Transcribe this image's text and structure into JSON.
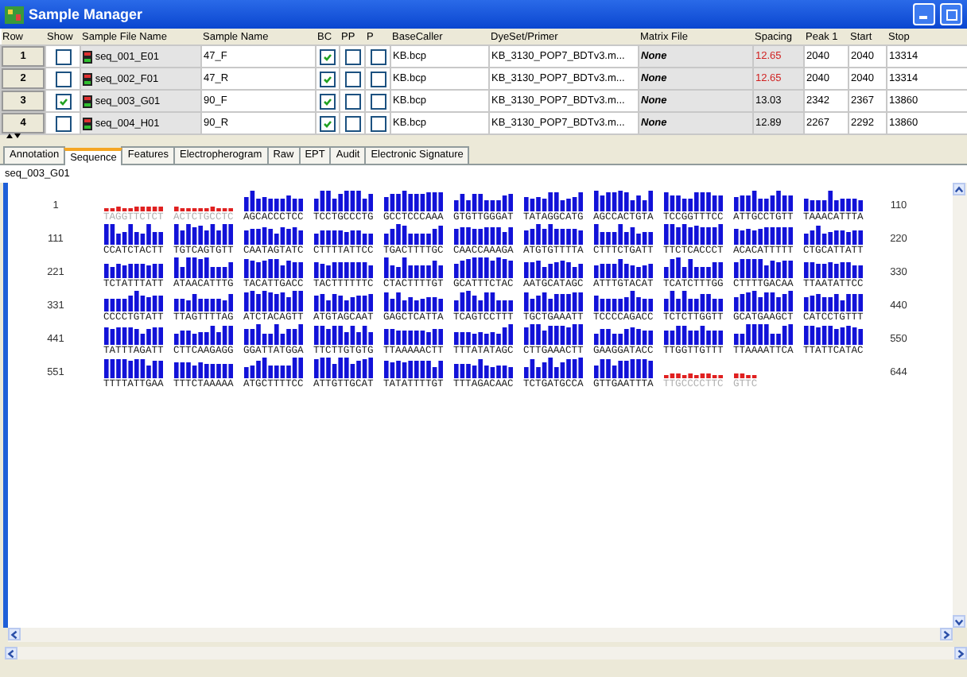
{
  "window": {
    "title": "Sample Manager"
  },
  "table": {
    "columns": [
      "Row",
      "Show",
      "Sample File Name",
      "Sample Name",
      "BC",
      "PP",
      "P",
      "BaseCaller",
      "DyeSet/Primer",
      "Matrix File",
      "Spacing",
      "Peak 1",
      "Start",
      "Stop"
    ],
    "rows": [
      {
        "row": "1",
        "show": false,
        "file": "seq_001_E01",
        "sample": "47_F",
        "bc": true,
        "pp": false,
        "p": false,
        "basecaller": "KB.bcp",
        "dyeset": "KB_3130_POP7_BDTv3.m...",
        "matrix": "None",
        "spacing": "12.65",
        "spacing_warning": true,
        "peak1": "2040",
        "start": "2040",
        "stop": "13314"
      },
      {
        "row": "2",
        "show": false,
        "file": "seq_002_F01",
        "sample": "47_R",
        "bc": true,
        "pp": false,
        "p": false,
        "basecaller": "KB.bcp",
        "dyeset": "KB_3130_POP7_BDTv3.m...",
        "matrix": "None",
        "spacing": "12.65",
        "spacing_warning": true,
        "peak1": "2040",
        "start": "2040",
        "stop": "13314"
      },
      {
        "row": "3",
        "show": true,
        "file": "seq_003_G01",
        "sample": "90_F",
        "bc": true,
        "pp": false,
        "p": false,
        "basecaller": "KB.bcp",
        "dyeset": "KB_3130_POP7_BDTv3.m...",
        "matrix": "None",
        "spacing": "13.03",
        "spacing_warning": false,
        "peak1": "2342",
        "start": "2367",
        "stop": "13860"
      },
      {
        "row": "4",
        "show": false,
        "file": "seq_004_H01",
        "sample": "90_R",
        "bc": true,
        "pp": false,
        "p": false,
        "basecaller": "KB.bcp",
        "dyeset": "KB_3130_POP7_BDTv3.m...",
        "matrix": "None",
        "spacing": "12.89",
        "spacing_warning": false,
        "peak1": "2267",
        "start": "2292",
        "stop": "13860"
      }
    ]
  },
  "tabs": [
    {
      "label": "Annotation",
      "selected": false
    },
    {
      "label": "Sequence",
      "selected": true
    },
    {
      "label": "Features",
      "selected": false
    },
    {
      "label": "Electropherogram",
      "selected": false
    },
    {
      "label": "Raw",
      "selected": false
    },
    {
      "label": "EPT",
      "selected": false
    },
    {
      "label": "Audit",
      "selected": false
    },
    {
      "label": "Electronic Signature",
      "selected": false
    }
  ],
  "sample_label": "seq_003_G01",
  "sequence": [
    {
      "start": "1",
      "end": "110",
      "groups": [
        {
          "bases": "TAGGTTCTCT",
          "low_quality": true
        },
        {
          "bases": "ACTCTGCCTC",
          "low_quality": true
        },
        {
          "bases": "AGCACCCTCC",
          "low_quality": false
        },
        {
          "bases": "TCCTGCCCTG",
          "low_quality": false
        },
        {
          "bases": "GCCTCCCAAA",
          "low_quality": false
        },
        {
          "bases": "GTGTTGGGAT",
          "low_quality": false
        },
        {
          "bases": "TATAGGCATG",
          "low_quality": false
        },
        {
          "bases": "AGCCACTGTA",
          "low_quality": false
        },
        {
          "bases": "TCCGGTTTCC",
          "low_quality": false
        },
        {
          "bases": "ATTGCCTGTT",
          "low_quality": false
        },
        {
          "bases": "TAAACATTTA",
          "low_quality": false
        }
      ]
    },
    {
      "start": "111",
      "end": "220",
      "groups": [
        {
          "bases": "CCATCTACTT",
          "low_quality": false
        },
        {
          "bases": "TGTCAGTGTT",
          "low_quality": false
        },
        {
          "bases": "CAATAGTATC",
          "low_quality": false
        },
        {
          "bases": "CTTTTATTCC",
          "low_quality": false
        },
        {
          "bases": "TGACTTTTGC",
          "low_quality": false
        },
        {
          "bases": "CAACCAAAGA",
          "low_quality": false
        },
        {
          "bases": "ATGTGTTTTA",
          "low_quality": false
        },
        {
          "bases": "CTTTCTGATT",
          "low_quality": false
        },
        {
          "bases": "TTCTCACCCT",
          "low_quality": false
        },
        {
          "bases": "ACACATTTTT",
          "low_quality": false
        },
        {
          "bases": "CTGCATTATT",
          "low_quality": false
        }
      ]
    },
    {
      "start": "221",
      "end": "330",
      "groups": [
        {
          "bases": "TCTATTTATT",
          "low_quality": false
        },
        {
          "bases": "ATAACATTTG",
          "low_quality": false
        },
        {
          "bases": "TACATTGACC",
          "low_quality": false
        },
        {
          "bases": "TACTTTTTTC",
          "low_quality": false
        },
        {
          "bases": "CTACTTTTGT",
          "low_quality": false
        },
        {
          "bases": "GCATTTCTAC",
          "low_quality": false
        },
        {
          "bases": "AATGCATAGC",
          "low_quality": false
        },
        {
          "bases": "ATTTGTACAT",
          "low_quality": false
        },
        {
          "bases": "TCATCTTTGG",
          "low_quality": false
        },
        {
          "bases": "CTTTTGACAA",
          "low_quality": false
        },
        {
          "bases": "TTAATATTCC",
          "low_quality": false
        }
      ]
    },
    {
      "start": "331",
      "end": "440",
      "groups": [
        {
          "bases": "CCCCTGTATT",
          "low_quality": false
        },
        {
          "bases": "TTAGTTTTAG",
          "low_quality": false
        },
        {
          "bases": "ATCTACAGTT",
          "low_quality": false
        },
        {
          "bases": "ATGTAGCAAT",
          "low_quality": false
        },
        {
          "bases": "GAGCTCATTA",
          "low_quality": false
        },
        {
          "bases": "TCAGTCCTTT",
          "low_quality": false
        },
        {
          "bases": "TGCTGAAATT",
          "low_quality": false
        },
        {
          "bases": "TCCCCAGACC",
          "low_quality": false
        },
        {
          "bases": "TCTCTTGGTT",
          "low_quality": false
        },
        {
          "bases": "GCATGAAGCT",
          "low_quality": false
        },
        {
          "bases": "CATCCTGTTT",
          "low_quality": false
        }
      ]
    },
    {
      "start": "441",
      "end": "550",
      "groups": [
        {
          "bases": "TATTTAGATT",
          "low_quality": false
        },
        {
          "bases": "CTTCAAGAGG",
          "low_quality": false
        },
        {
          "bases": "GGATTATGGA",
          "low_quality": false
        },
        {
          "bases": "TTCTTGTGTG",
          "low_quality": false
        },
        {
          "bases": "TTAAAAACTT",
          "low_quality": false
        },
        {
          "bases": "TTTATATAGC",
          "low_quality": false
        },
        {
          "bases": "CTTGAAACTT",
          "low_quality": false
        },
        {
          "bases": "GAAGGATACC",
          "low_quality": false
        },
        {
          "bases": "TTGGTTGTTT",
          "low_quality": false
        },
        {
          "bases": "TTAAAATTCA",
          "low_quality": false
        },
        {
          "bases": "TTATTCATAC",
          "low_quality": false
        }
      ]
    },
    {
      "start": "551",
      "end": "644",
      "groups": [
        {
          "bases": "TTTTATTGAA",
          "low_quality": false
        },
        {
          "bases": "TTTCTAAAAA",
          "low_quality": false
        },
        {
          "bases": "ATGCTTTTCC",
          "low_quality": false
        },
        {
          "bases": "ATTGTTGCAT",
          "low_quality": false
        },
        {
          "bases": "TATATTTTGT",
          "low_quality": false
        },
        {
          "bases": "TTTAGACAAC",
          "low_quality": false
        },
        {
          "bases": "TCTGATGCCA",
          "low_quality": false
        },
        {
          "bases": "GTTGAATTTA",
          "low_quality": false
        },
        {
          "bases": "TTGCCCCTTC",
          "low_quality": true
        },
        {
          "bases": "GTTC",
          "low_quality": true
        }
      ]
    }
  ]
}
